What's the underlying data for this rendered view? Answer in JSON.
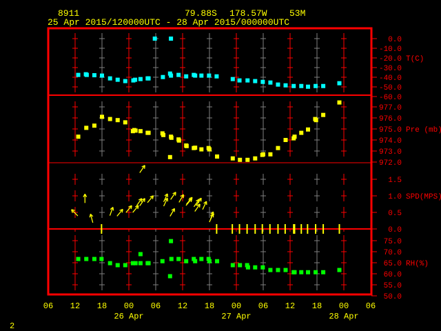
{
  "header": {
    "station_id": "8911",
    "latitude": "79.88S",
    "longitude": "178.57W",
    "elevation": "53M",
    "time_range": "25 Apr 2015/120000UTC - 28 Apr 2015/000000UTC"
  },
  "footer": {
    "page_number": "2"
  },
  "colors": {
    "frame": "#ff0000",
    "text": "#ffff00",
    "temperature": "#00ffff",
    "pressure": "#ffff00",
    "wind": "#ffff00",
    "humidity": "#00ff00",
    "grid_minor": "#808080"
  },
  "chart_data": {
    "type": "scatter",
    "x_axis": {
      "unit": "hours since 25 Apr 06UTC",
      "range": [
        0,
        72
      ],
      "tick_hours": [
        0,
        6,
        12,
        18,
        24,
        30,
        36,
        42,
        48,
        54,
        60,
        66,
        72
      ],
      "tick_labels": [
        "06",
        "12",
        "18",
        "00",
        "06",
        "12",
        "18",
        "00",
        "06",
        "12",
        "18",
        "00",
        "06"
      ],
      "date_labels": [
        {
          "hour": 18,
          "label": "26 Apr"
        },
        {
          "hour": 42,
          "label": "27 Apr"
        },
        {
          "hour": 66,
          "label": "28 Apr"
        }
      ]
    },
    "panels": [
      {
        "name": "temperature",
        "label": "T(C)",
        "range": [
          -60,
          0
        ],
        "ticks": [
          "0.0",
          "-10.0",
          "-20.0",
          "-30.0",
          "-40.0",
          "-50.0",
          "-60.0"
        ],
        "tick_values": [
          0,
          -10,
          -20,
          -30,
          -40,
          -50,
          -60
        ],
        "points": [
          [
            6.7,
            -37.6
          ],
          [
            8.4,
            -36.9
          ],
          [
            8.6,
            -37.6
          ],
          [
            10.3,
            -37.9
          ],
          [
            12.0,
            -38.3
          ],
          [
            13.8,
            -41.2
          ],
          [
            15.5,
            -42.6
          ],
          [
            17.2,
            -44.0
          ],
          [
            19.0,
            -43.3
          ],
          [
            19.4,
            -42.6
          ],
          [
            20.6,
            -41.9
          ],
          [
            22.2,
            -41.2
          ],
          [
            22.4,
            -41.2
          ],
          [
            23.8,
            0.0
          ],
          [
            25.6,
            -39.8
          ],
          [
            27.2,
            -36.2
          ],
          [
            27.4,
            -38.3
          ],
          [
            27.4,
            0.0
          ],
          [
            29.1,
            -37.6
          ],
          [
            30.8,
            -39.1
          ],
          [
            32.5,
            -37.6
          ],
          [
            32.8,
            -38.3
          ],
          [
            34.2,
            -38.3
          ],
          [
            35.9,
            -38.3
          ],
          [
            37.6,
            -39.1
          ],
          [
            41.2,
            -41.9
          ],
          [
            42.7,
            -43.3
          ],
          [
            44.5,
            -43.3
          ],
          [
            46.2,
            -44.0
          ],
          [
            47.9,
            -44.8
          ],
          [
            49.6,
            -45.5
          ],
          [
            51.3,
            -47.6
          ],
          [
            53.0,
            -48.4
          ],
          [
            54.8,
            -49.1
          ],
          [
            56.5,
            -49.1
          ],
          [
            58.0,
            -49.8
          ],
          [
            59.7,
            -49.1
          ],
          [
            61.4,
            -49.1
          ],
          [
            65.0,
            -46.2
          ]
        ]
      },
      {
        "name": "pressure",
        "label": "Pre (mb)",
        "range": [
          972,
          977
        ],
        "ticks": [
          "977.0",
          "976.0",
          "975.0",
          "974.0",
          "973.0",
          "972.0"
        ],
        "tick_values": [
          977,
          976,
          975,
          974,
          973,
          972
        ],
        "points": [
          [
            6.7,
            974.3
          ],
          [
            8.5,
            975.1
          ],
          [
            10.3,
            975.3
          ],
          [
            12.0,
            976.1
          ],
          [
            13.8,
            975.9
          ],
          [
            15.5,
            975.8
          ],
          [
            17.2,
            975.6
          ],
          [
            18.9,
            974.8
          ],
          [
            19.2,
            974.9
          ],
          [
            19.5,
            974.85
          ],
          [
            20.6,
            974.8
          ],
          [
            22.2,
            974.65
          ],
          [
            22.4,
            974.65
          ],
          [
            25.5,
            974.6
          ],
          [
            25.7,
            974.45
          ],
          [
            27.2,
            972.45
          ],
          [
            27.4,
            974.3
          ],
          [
            27.5,
            974.2
          ],
          [
            29.1,
            974.05
          ],
          [
            29.2,
            973.95
          ],
          [
            30.8,
            973.5
          ],
          [
            30.9,
            973.45
          ],
          [
            32.5,
            973.27
          ],
          [
            32.8,
            973.3
          ],
          [
            34.2,
            973.15
          ],
          [
            35.8,
            973.27
          ],
          [
            36.0,
            973.15
          ],
          [
            37.7,
            972.5
          ],
          [
            41.2,
            972.33
          ],
          [
            42.8,
            972.2
          ],
          [
            44.5,
            972.2
          ],
          [
            46.2,
            972.33
          ],
          [
            47.8,
            972.65
          ],
          [
            48.0,
            972.7
          ],
          [
            49.6,
            972.7
          ],
          [
            51.3,
            973.27
          ],
          [
            53.0,
            974.0
          ],
          [
            54.8,
            974.15
          ],
          [
            55.0,
            974.3
          ],
          [
            56.5,
            974.65
          ],
          [
            58.0,
            974.95
          ],
          [
            59.6,
            975.9
          ],
          [
            59.8,
            975.8
          ],
          [
            61.4,
            976.27
          ],
          [
            65.0,
            977.4
          ]
        ]
      },
      {
        "name": "wind_speed",
        "label": "SPD(MPS)",
        "range": [
          0,
          1.5
        ],
        "ticks": [
          "1.5",
          "1.0",
          "0.5",
          "0.0"
        ],
        "tick_values": [
          1.5,
          1.0,
          0.5,
          0.0
        ],
        "arrows": [
          [
            5.9,
            0.49,
            315
          ],
          [
            8.2,
            0.92,
            0
          ],
          [
            9.7,
            0.32,
            345
          ],
          [
            14.1,
            0.53,
            20
          ],
          [
            16.0,
            0.49,
            40
          ],
          [
            18.0,
            0.6,
            40
          ],
          [
            19.5,
            0.6,
            40
          ],
          [
            20.3,
            0.81,
            35
          ],
          [
            21.0,
            1.81,
            35
          ],
          [
            21.0,
            0.81,
            35
          ],
          [
            22.8,
            0.9,
            40
          ],
          [
            26.2,
            0.81,
            25
          ],
          [
            26.2,
            0.94,
            25
          ],
          [
            27.7,
            0.5,
            30
          ],
          [
            27.9,
            1.0,
            35
          ],
          [
            29.7,
            0.92,
            30
          ],
          [
            31.4,
            0.81,
            40
          ],
          [
            31.5,
            0.85,
            40
          ],
          [
            33.1,
            0.78,
            35
          ],
          [
            33.3,
            0.64,
            35
          ],
          [
            33.6,
            0.82,
            35
          ],
          [
            34.9,
            0.71,
            25
          ],
          [
            36.4,
            0.33,
            25
          ],
          [
            36.5,
            0.39,
            20
          ]
        ],
        "calm_hours": [
          11.9,
          37.6,
          41.1,
          42.7,
          44.4,
          46.2,
          47.8,
          49.5,
          51.3,
          52.9,
          54.8,
          55.0,
          56.5,
          57.9,
          59.7,
          61.4,
          65.0
        ]
      },
      {
        "name": "relative_humidity",
        "label": "RH(%)",
        "range": [
          50,
          75
        ],
        "ticks": [
          "75.0",
          "70.0",
          "65.0",
          "60.0",
          "55.0",
          "50.0"
        ],
        "tick_values": [
          75,
          70,
          65,
          60,
          55,
          50
        ],
        "points": [
          [
            6.7,
            66.7
          ],
          [
            8.5,
            66.7
          ],
          [
            10.3,
            66.7
          ],
          [
            11.9,
            66.7
          ],
          [
            13.8,
            64.8
          ],
          [
            15.5,
            63.9
          ],
          [
            17.2,
            63.9
          ],
          [
            18.9,
            64.8
          ],
          [
            19.5,
            64.8
          ],
          [
            20.6,
            68.9
          ],
          [
            20.6,
            64.8
          ],
          [
            22.2,
            64.8
          ],
          [
            22.4,
            64.8
          ],
          [
            25.5,
            65.7
          ],
          [
            27.4,
            74.8
          ],
          [
            27.2,
            58.9
          ],
          [
            27.5,
            66.7
          ],
          [
            29.1,
            66.7
          ],
          [
            30.8,
            65.7
          ],
          [
            32.5,
            66.7
          ],
          [
            32.8,
            65.7
          ],
          [
            34.2,
            66.7
          ],
          [
            35.8,
            66.7
          ],
          [
            36.0,
            65.7
          ],
          [
            37.7,
            65.7
          ],
          [
            41.2,
            63.9
          ],
          [
            42.8,
            63.9
          ],
          [
            44.4,
            63.9
          ],
          [
            44.6,
            62.9
          ],
          [
            46.2,
            62.9
          ],
          [
            47.9,
            62.9
          ],
          [
            49.6,
            61.7
          ],
          [
            51.3,
            61.7
          ],
          [
            53.0,
            61.7
          ],
          [
            54.8,
            60.7
          ],
          [
            55.0,
            60.7
          ],
          [
            56.5,
            60.7
          ],
          [
            58.0,
            60.7
          ],
          [
            59.7,
            60.7
          ],
          [
            61.4,
            60.7
          ],
          [
            65.0,
            61.7
          ]
        ]
      }
    ]
  }
}
